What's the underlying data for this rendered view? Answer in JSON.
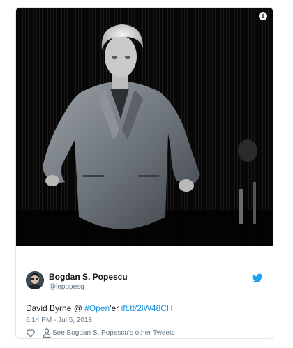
{
  "tweet": {
    "author_name": "Bogdan S. Popescu",
    "author_handle": "@lepopesq",
    "text_prefix": "David Byrne @ ",
    "hashtag_hash": "#",
    "hashtag_word": "Open",
    "text_suffix": "'er ",
    "link_text": "ift.tt/2lW48CH",
    "timestamp": "6:14 PM - Jul 5, 2018",
    "other_tweets_label": "See Bogdan S. Popescu's other Tweets"
  },
  "media": {
    "info_icon_glyph": "i",
    "description_icon": "info-icon"
  },
  "icons": {
    "brand": "twitter-bird-icon",
    "like": "heart-icon",
    "profile": "person-icon"
  },
  "colors": {
    "link": "#1b95e0",
    "secondary_text": "#657786",
    "primary_text": "#14171a",
    "border": "#e1e8ed",
    "twitter_blue": "#1da1f2"
  }
}
